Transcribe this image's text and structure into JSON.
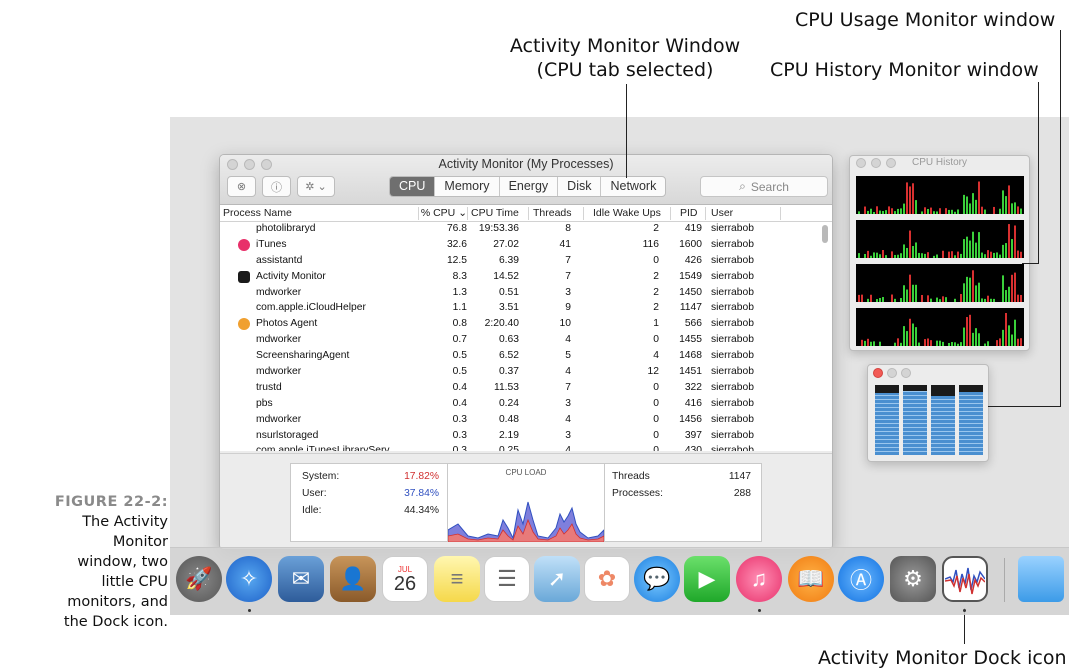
{
  "annotations": {
    "cpu_usage": "CPU Usage Monitor window",
    "am_window_line1": "Activity Monitor Window",
    "am_window_line2": "(CPU tab selected)",
    "cpu_history": "CPU History Monitor window",
    "dock_icon": "Activity Monitor Dock icon"
  },
  "caption": {
    "label": "FIGURE 22-2:",
    "lines": [
      "The Activity",
      "Monitor",
      "window, two",
      "little CPU",
      "monitors, and",
      "the Dock icon."
    ]
  },
  "window": {
    "title": "Activity Monitor (My Processes)",
    "tabs": [
      "CPU",
      "Memory",
      "Energy",
      "Disk",
      "Network"
    ],
    "selected_tab": "CPU",
    "search_placeholder": "Search"
  },
  "table": {
    "columns": [
      "Process Name",
      "% CPU",
      "CPU Time",
      "Threads",
      "Idle Wake Ups",
      "PID",
      "User"
    ],
    "sort_column": "% CPU",
    "rows": [
      {
        "name": "photolibraryd",
        "cpu": "76.8",
        "time": "19:53.36",
        "threads": "8",
        "idle": "2",
        "pid": "419",
        "user": "sierrabob",
        "icon": ""
      },
      {
        "name": "iTunes",
        "cpu": "32.6",
        "time": "27.02",
        "threads": "41",
        "idle": "116",
        "pid": "1600",
        "user": "sierrabob",
        "icon": "itunes-icon"
      },
      {
        "name": "assistantd",
        "cpu": "12.5",
        "time": "6.39",
        "threads": "7",
        "idle": "0",
        "pid": "426",
        "user": "sierrabob",
        "icon": ""
      },
      {
        "name": "Activity Monitor",
        "cpu": "8.3",
        "time": "14.52",
        "threads": "7",
        "idle": "2",
        "pid": "1549",
        "user": "sierrabob",
        "icon": "activity-monitor-icon"
      },
      {
        "name": "mdworker",
        "cpu": "1.3",
        "time": "0.51",
        "threads": "3",
        "idle": "2",
        "pid": "1450",
        "user": "sierrabob",
        "icon": ""
      },
      {
        "name": "com.apple.iCloudHelper",
        "cpu": "1.1",
        "time": "3.51",
        "threads": "9",
        "idle": "2",
        "pid": "1147",
        "user": "sierrabob",
        "icon": ""
      },
      {
        "name": "Photos Agent",
        "cpu": "0.8",
        "time": "2:20.40",
        "threads": "10",
        "idle": "1",
        "pid": "566",
        "user": "sierrabob",
        "icon": "photos-icon"
      },
      {
        "name": "mdworker",
        "cpu": "0.7",
        "time": "0.63",
        "threads": "4",
        "idle": "0",
        "pid": "1455",
        "user": "sierrabob",
        "icon": ""
      },
      {
        "name": "ScreensharingAgent",
        "cpu": "0.5",
        "time": "6.52",
        "threads": "5",
        "idle": "4",
        "pid": "1468",
        "user": "sierrabob",
        "icon": ""
      },
      {
        "name": "mdworker",
        "cpu": "0.5",
        "time": "0.37",
        "threads": "4",
        "idle": "12",
        "pid": "1451",
        "user": "sierrabob",
        "icon": ""
      },
      {
        "name": "trustd",
        "cpu": "0.4",
        "time": "11.53",
        "threads": "7",
        "idle": "0",
        "pid": "322",
        "user": "sierrabob",
        "icon": ""
      },
      {
        "name": "pbs",
        "cpu": "0.4",
        "time": "0.24",
        "threads": "3",
        "idle": "0",
        "pid": "416",
        "user": "sierrabob",
        "icon": ""
      },
      {
        "name": "mdworker",
        "cpu": "0.3",
        "time": "0.48",
        "threads": "4",
        "idle": "0",
        "pid": "1456",
        "user": "sierrabob",
        "icon": ""
      },
      {
        "name": "nsurlstoraged",
        "cpu": "0.3",
        "time": "2.19",
        "threads": "3",
        "idle": "0",
        "pid": "397",
        "user": "sierrabob",
        "icon": ""
      },
      {
        "name": "com.apple.iTunesLibraryServ",
        "cpu": "0.3",
        "time": "0.25",
        "threads": "4",
        "idle": "0",
        "pid": "430",
        "user": "sierrabob",
        "icon": ""
      }
    ]
  },
  "stats": {
    "system_label": "System:",
    "system_value": "17.82%",
    "user_label": "User:",
    "user_value": "37.84%",
    "idle_label": "Idle:",
    "idle_value": "44.34%",
    "cpu_load_title": "CPU LOAD",
    "threads_label": "Threads",
    "threads_value": "1147",
    "processes_label": "Processes:",
    "processes_value": "288"
  },
  "cpu_history_title": "CPU History",
  "usage_levels": [
    0.88,
    0.92,
    0.85,
    0.9
  ],
  "dock_date": {
    "month": "JUL",
    "day": "26"
  },
  "colors": {
    "system": "#d03030",
    "user": "#3050c0",
    "usage_bar": "#4a8fd0"
  }
}
